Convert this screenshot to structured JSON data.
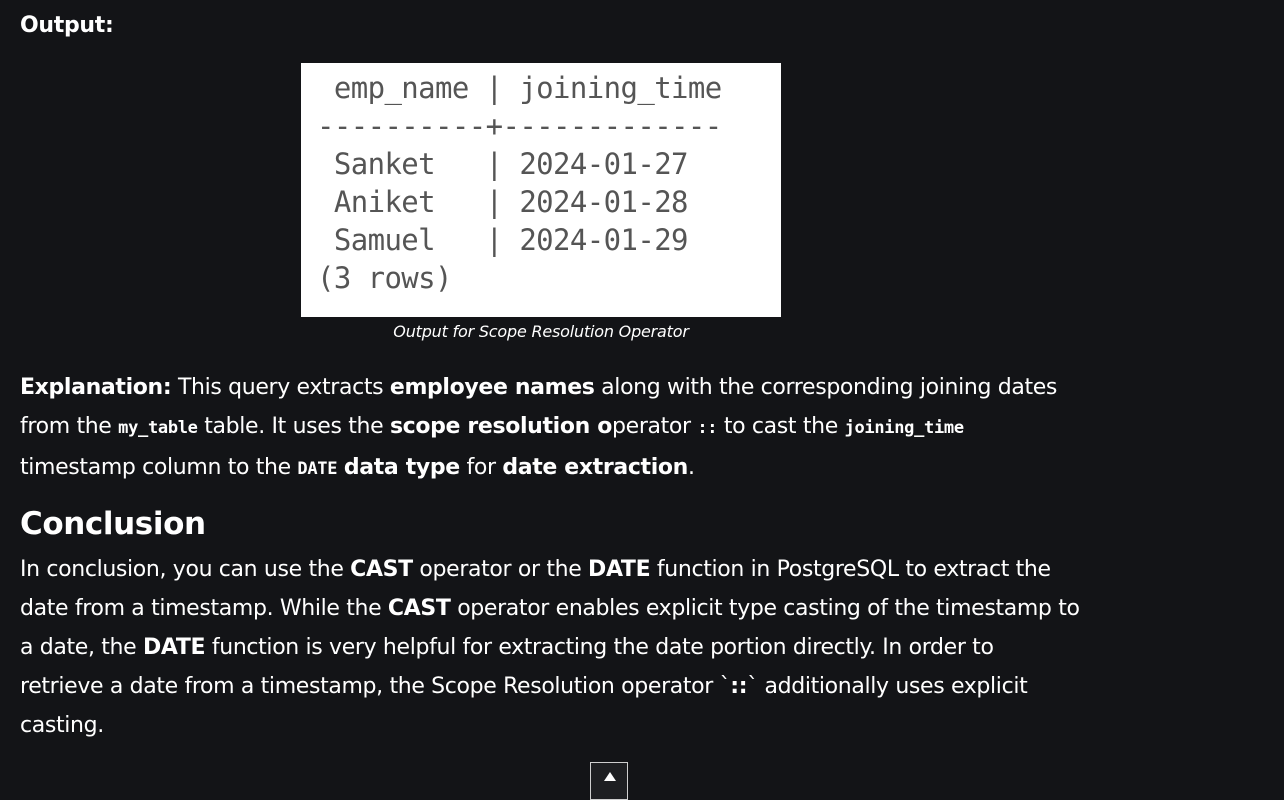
{
  "output_label": "Output:",
  "figure": {
    "lines": [
      " emp_name | joining_time",
      "----------+-------------",
      " Sanket   | 2024-01-27",
      " Aniket   | 2024-01-28",
      " Samuel   | 2024-01-29",
      "(3 rows)"
    ],
    "caption": "Output for Scope Resolution Operator"
  },
  "explanation": {
    "label": "Explanation:",
    "t1": " This query extracts ",
    "b1": "employee names",
    "t2": " along with the corresponding joining dates from the ",
    "c1": "my_table",
    "t3": " table. It uses the ",
    "b2": "scope resolution o",
    "t4": "perator ",
    "c2": "::",
    "t5": " to cast the ",
    "c3": "joining_time",
    "t6": " timestamp column to the ",
    "c4": "DATE",
    "t7": " ",
    "b3": "data type",
    "t8": " for ",
    "b4": "date extraction",
    "t9": "."
  },
  "conclusion": {
    "heading": "Conclusion",
    "t1": "In conclusion, you can use the ",
    "b1": "CAST",
    "t2": " operator or the ",
    "b2": "DATE",
    "t3": " function in PostgreSQL to extract the date from a timestamp. While the ",
    "b3": "CAST",
    "t4": " operator enables explicit type casting of the timestamp to a date, the ",
    "b4": "DATE",
    "t5": " function is very helpful for extracting the date portion directly. In order to retrieve a date from a timestamp, the Scope Resolution operator `",
    "b5": "::",
    "t6": "` additionally uses explicit casting."
  },
  "scroll_top": {
    "icon": "chevron-up-icon"
  }
}
